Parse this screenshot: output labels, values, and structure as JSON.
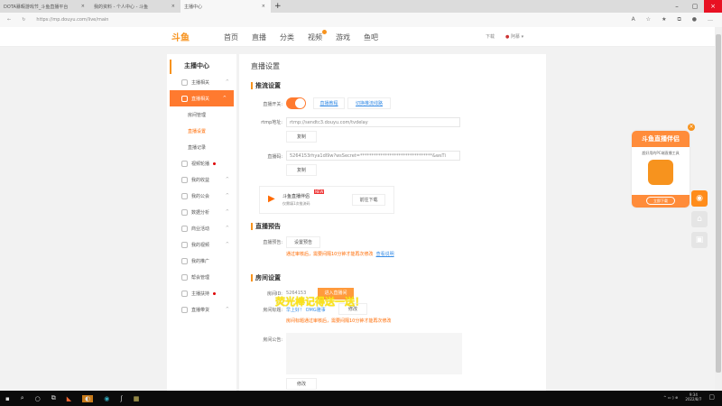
{
  "browser": {
    "tabs": [
      {
        "title": "DOTA暴暇游戏节_斗鱼直播平台"
      },
      {
        "title": "我的资料 - 个人中心 - 斗鱼"
      },
      {
        "title": "主播中心"
      }
    ],
    "url": "https://mp.douyu.com/live/main"
  },
  "header": {
    "logo": "斗鱼",
    "nav": [
      "首页",
      "直播",
      "分类",
      "视频",
      "游戏",
      "鱼吧"
    ],
    "download": "下载",
    "user": "阿慕"
  },
  "sidebar": {
    "title": "主播中心",
    "items": [
      {
        "label": "主播相关",
        "type": "item",
        "chev": "^"
      },
      {
        "label": "直播相关",
        "type": "active",
        "chev": "^"
      },
      {
        "label": "房间管理",
        "type": "sub"
      },
      {
        "label": "直播设置",
        "type": "cur"
      },
      {
        "label": "直播记录",
        "type": "sub"
      },
      {
        "label": "视频轮播",
        "type": "item",
        "dot": true
      },
      {
        "label": "我的收益",
        "type": "item",
        "chev": "^"
      },
      {
        "label": "我的公会",
        "type": "item",
        "chev": "^"
      },
      {
        "label": "数据分析",
        "type": "item",
        "chev": "^"
      },
      {
        "label": "商业活动",
        "type": "item",
        "chev": "^"
      },
      {
        "label": "我的视频",
        "type": "item",
        "chev": "^"
      },
      {
        "label": "我的推广",
        "type": "item"
      },
      {
        "label": "帮会管理",
        "type": "item"
      },
      {
        "label": "主播扶持",
        "type": "item",
        "dot": true
      },
      {
        "label": "直播带货",
        "type": "item",
        "chev": "^"
      }
    ]
  },
  "main": {
    "title": "直播设置",
    "push": {
      "heading": "推流设置",
      "switch_label": "直播开关:",
      "switch_on": true,
      "tutorial": "直播教程",
      "switch_line": "切换推流线路",
      "rtmp_label": "rtmp地址:",
      "rtmp_value": "rtmp://sendtc3.douyu.com/tvdelay",
      "copy": "复制",
      "code_label": "直播码:",
      "code_value": "5264153rhya1dl9w?wsSecret=********************************&wsTi",
      "promo_title": "斗鱼直播伴侣",
      "promo_badge": "NEW",
      "promo_sub": "仅需填1次推流码",
      "promo_btn": "前往下载"
    },
    "notice": {
      "heading": "直播预告",
      "label": "直播预告:",
      "btn": "设置预告",
      "warn": "通过审核后，需要间隔10分钟才能再次修改",
      "link": "查看说明"
    },
    "room": {
      "heading": "房间设置",
      "id_label": "房间ID:",
      "id_value": "5264153",
      "enter_btn": "进入直播间",
      "title_label": "房间标题:",
      "title_value": "早上好！ OMG雅事",
      "edit": "修改",
      "title_warn": "房间标题通过审核后，需要间隔10分钟才能再次修改",
      "announce_label": "房间公告:",
      "edit2": "修改"
    },
    "overlay": "荧光棒记得送一送！"
  },
  "float_ad": {
    "title": "斗鱼直播伴侣",
    "sub": "超好用的PC端直播工具",
    "btn": "立即下载"
  },
  "taskbar": {
    "time": "9:34",
    "date": "2022/8/7"
  }
}
